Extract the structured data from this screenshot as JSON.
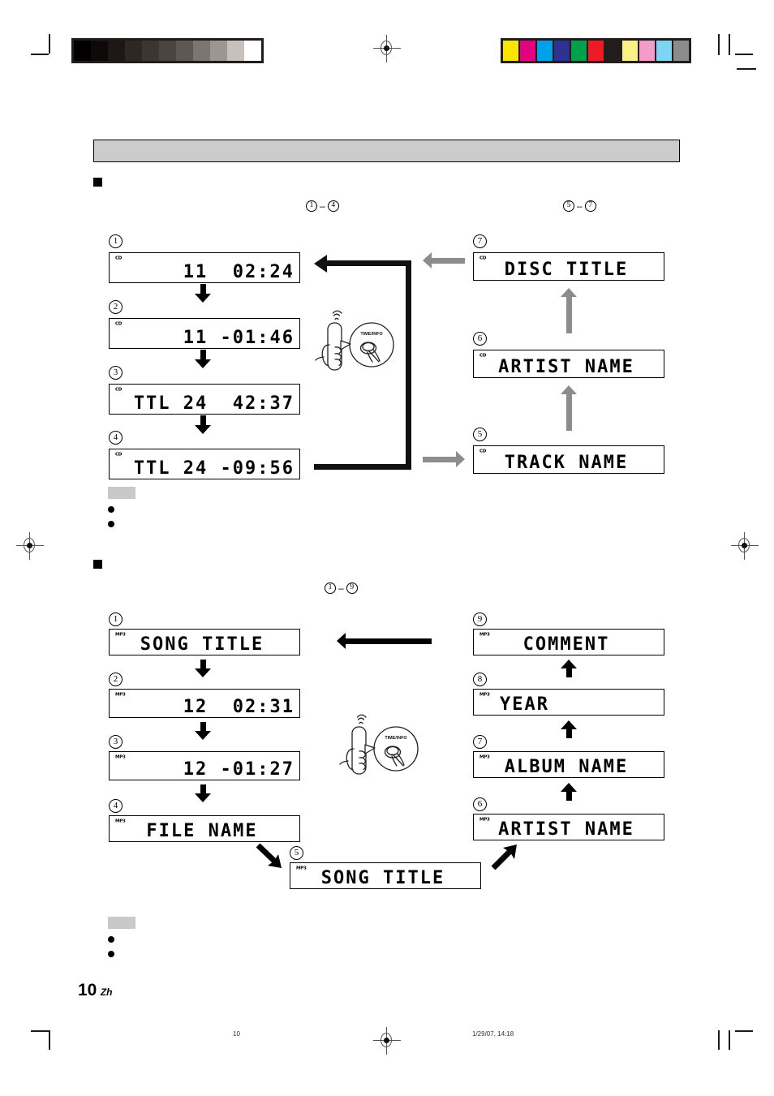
{
  "page": {
    "number": "10",
    "language_code": "Zh",
    "footer_page_label": "10",
    "footer_timestamp": "1/29/07, 14:18"
  },
  "header_bar": {
    "title": ""
  },
  "print_marks": {
    "grayscale_swatches": [
      "#000000",
      "#0d0a09",
      "#1d1816",
      "#2e2824",
      "#3c3531",
      "#4c4440",
      "#5f5752",
      "#7d7570",
      "#9d9590",
      "#c7c0bb",
      "#ffffff"
    ],
    "color_swatches": [
      "#fbe500",
      "#e4007f",
      "#00a0e9",
      "#2e3192",
      "#00a14b",
      "#ed1c24",
      "#221d1b",
      "#fbef87",
      "#f59bc8",
      "#7fd4f5",
      "#8c8c8c"
    ]
  },
  "sections": [
    {
      "id": "cd-section",
      "heading": "",
      "left_range_caption": {
        "from": "1",
        "to": "4",
        "dash": "–"
      },
      "right_range_caption": {
        "from": "5",
        "to": "7",
        "dash": "–"
      },
      "remote": {
        "button_label": "TIME/INFO"
      },
      "left_displays": [
        {
          "num": "1",
          "source": "CD",
          "text": "11  02:24",
          "align": "right"
        },
        {
          "num": "2",
          "source": "CD",
          "text": "11 -01:46",
          "align": "right"
        },
        {
          "num": "3",
          "source": "CD",
          "text": "TTL 24  42:37",
          "align": "right"
        },
        {
          "num": "4",
          "source": "CD",
          "text": "TTL 24 -09:56",
          "align": "right"
        }
      ],
      "right_displays": [
        {
          "num": "7",
          "source": "CD",
          "text": "DISC TITLE",
          "align": "center"
        },
        {
          "num": "6",
          "source": "CD",
          "text": "ARTIST NAME",
          "align": "center"
        },
        {
          "num": "5",
          "source": "CD",
          "text": "TRACK NAME",
          "align": "center"
        }
      ],
      "notes": {
        "chip": "",
        "bullets": [
          "",
          ""
        ]
      }
    },
    {
      "id": "mp3-section",
      "heading": "",
      "range_caption": {
        "from": "1",
        "to": "9",
        "dash": "–"
      },
      "remote": {
        "button_label": "TIME/INFO"
      },
      "left_displays": [
        {
          "num": "1",
          "source": "MP3",
          "text": "SONG TITLE",
          "align": "center"
        },
        {
          "num": "2",
          "source": "MP3",
          "text": "12  02:31",
          "align": "right"
        },
        {
          "num": "3",
          "source": "MP3",
          "text": "12 -01:27",
          "align": "right"
        },
        {
          "num": "4",
          "source": "MP3",
          "text": "FILE NAME",
          "align": "center"
        }
      ],
      "center_display": {
        "num": "5",
        "source": "MP3",
        "text": "SONG TITLE",
        "align": "center"
      },
      "right_displays": [
        {
          "num": "9",
          "source": "MP3",
          "text": "COMMENT",
          "align": "center"
        },
        {
          "num": "8",
          "source": "MP3",
          "text": "YEAR",
          "align": "center"
        },
        {
          "num": "7",
          "source": "MP3",
          "text": "ALBUM NAME",
          "align": "center"
        },
        {
          "num": "6",
          "source": "MP3",
          "text": "ARTIST NAME",
          "align": "center"
        }
      ],
      "notes": {
        "chip": "",
        "bullets": [
          "",
          ""
        ]
      }
    }
  ],
  "colors": {
    "heading_bar_fill": "#cccccc",
    "note_chip_fill": "#c9c9c9",
    "gray_arrow": "#8c8c8c",
    "black": "#000000"
  }
}
